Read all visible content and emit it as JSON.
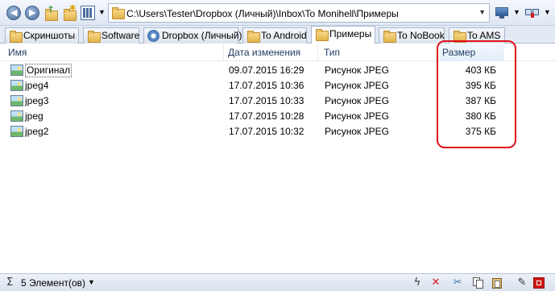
{
  "toolbar": {
    "back_icon": "back-arrow-icon",
    "forward_icon": "forward-arrow-icon",
    "up_icon": "up-folder-icon",
    "new_folder_icon": "new-folder-icon",
    "view_icon": "view-mode-icon",
    "address": "C:\\Users\\Tester\\Dropbox (Личный)\\Inbox\\To Monihell\\Примеры"
  },
  "tabs": [
    {
      "label": "Скриншоты",
      "active": false
    },
    {
      "label": "Software",
      "active": false
    },
    {
      "label": "Dropbox (Личный)",
      "active": false
    },
    {
      "label": "To Android",
      "active": false
    },
    {
      "label": "Примеры",
      "active": true
    },
    {
      "label": "To NoBook",
      "active": false
    },
    {
      "label": "To AMS",
      "active": false
    }
  ],
  "columns": {
    "name": "Имя",
    "date": "Дата изменения",
    "type": "Тип",
    "size": "Размер"
  },
  "files": [
    {
      "name": "Оригинал",
      "date": "09.07.2015 16:29",
      "type": "Рисунок JPEG",
      "size": "403 КБ"
    },
    {
      "name": "jpeg4",
      "date": "17.07.2015 10:36",
      "type": "Рисунок JPEG",
      "size": "395 КБ"
    },
    {
      "name": "jpeg3",
      "date": "17.07.2015 10:33",
      "type": "Рисунок JPEG",
      "size": "387 КБ"
    },
    {
      "name": "jpeg",
      "date": "17.07.2015 10:28",
      "type": "Рисунок JPEG",
      "size": "380 КБ"
    },
    {
      "name": "jpeg2",
      "date": "17.07.2015 10:32",
      "type": "Рисунок JPEG",
      "size": "375 КБ"
    }
  ],
  "status": {
    "count": "5 Элемент(ов)"
  },
  "colors": {
    "highlight": "#e0101a",
    "accent": "#4b6e9e"
  }
}
